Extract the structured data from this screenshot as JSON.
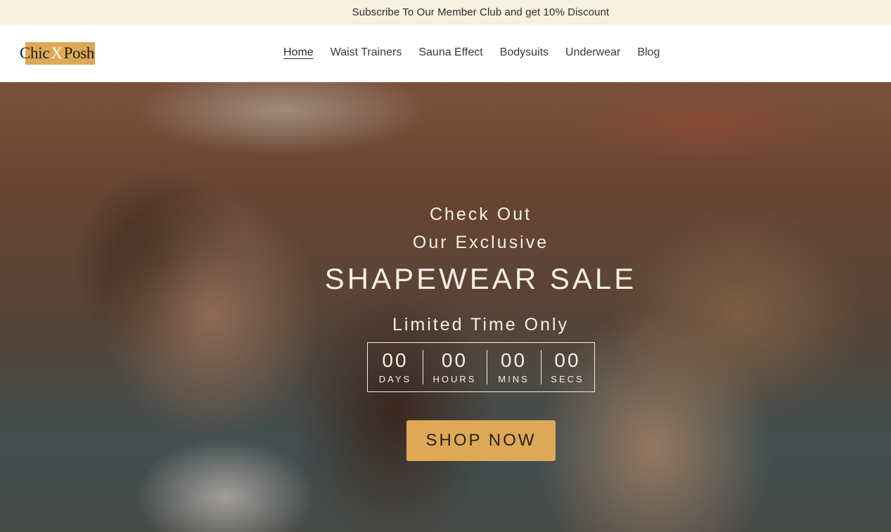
{
  "announcement": {
    "text": "Subscribe To Our Member Club and get 10% Discount"
  },
  "brand": {
    "left": "Chic",
    "middle": "X",
    "right": "Posh",
    "accent_color": "#dea956"
  },
  "nav": {
    "items": [
      {
        "label": "Home",
        "active": true
      },
      {
        "label": "Waist Trainers",
        "active": false
      },
      {
        "label": "Sauna Effect",
        "active": false
      },
      {
        "label": "Bodysuits",
        "active": false
      },
      {
        "label": "Underwear",
        "active": false
      },
      {
        "label": "Blog",
        "active": false
      }
    ]
  },
  "hero": {
    "line1": "Check Out",
    "line2": "Our Exclusive",
    "headline": "SHAPEWEAR SALE",
    "subline": "Limited Time Only",
    "countdown": [
      {
        "value": "00",
        "label": "DAYS"
      },
      {
        "value": "00",
        "label": "HOURS"
      },
      {
        "value": "00",
        "label": "MINS"
      },
      {
        "value": "00",
        "label": "SECS"
      }
    ],
    "cta_label": "SHOP NOW",
    "cta_color": "#dea956"
  },
  "colors": {
    "announcement_bg": "#f8f1e0",
    "header_bg": "#ffffff",
    "hero_text": "#f6efe4"
  }
}
